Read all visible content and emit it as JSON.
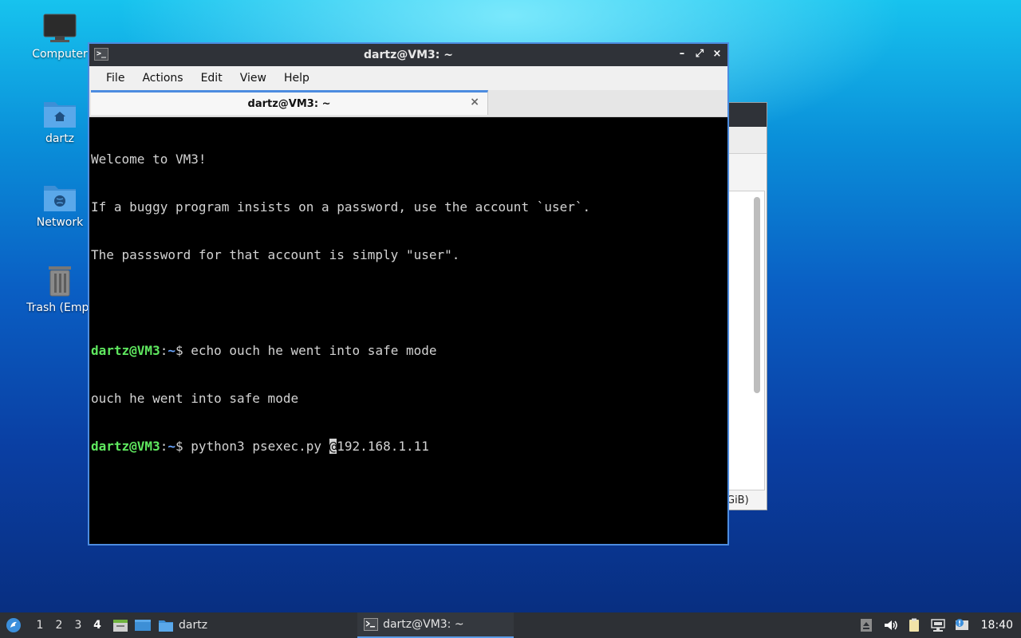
{
  "desktop": {
    "icons": [
      {
        "label": "Computer"
      },
      {
        "label": "dartz"
      },
      {
        "label": "Network"
      },
      {
        "label": "Trash (Empt"
      }
    ]
  },
  "background_window": {
    "status_text": "GiB)"
  },
  "terminal": {
    "title": "dartz@VM3: ~",
    "menu": [
      "File",
      "Actions",
      "Edit",
      "View",
      "Help"
    ],
    "tab_title": "dartz@VM3: ~",
    "tab_close": "×",
    "controls": {
      "minimize": "–",
      "maximize": "⤢",
      "close": "×"
    },
    "lines": [
      {
        "text": "Welcome to VM3!"
      },
      {
        "text": "If a buggy program insists on a password, use the account `user`."
      },
      {
        "text": "The passsword for that account is simply \"user\"."
      },
      {
        "text": ""
      },
      {
        "user": "dartz@VM3",
        "sep": ":",
        "path": "~",
        "symbol": "$ ",
        "cmd": "echo ouch he went into safe mode"
      },
      {
        "text": "ouch he went into safe mode"
      },
      {
        "user": "dartz@VM3",
        "sep": ":",
        "path": "~",
        "symbol": "$ ",
        "cmd_before": "python3 psexec.py ",
        "cursor_char": "@",
        "cmd_after": "192.168.1.11"
      }
    ]
  },
  "taskbar": {
    "workspaces": [
      "1",
      "2",
      "3",
      "4"
    ],
    "active_workspace": "4",
    "tasks": [
      {
        "label": "dartz"
      },
      {
        "label": "dartz@VM3: ~"
      }
    ],
    "clock": "18:40"
  },
  "colors": {
    "prompt_user": "#5fe85f",
    "prompt_path": "#6aa6ff",
    "window_border": "#4c8ce0"
  }
}
